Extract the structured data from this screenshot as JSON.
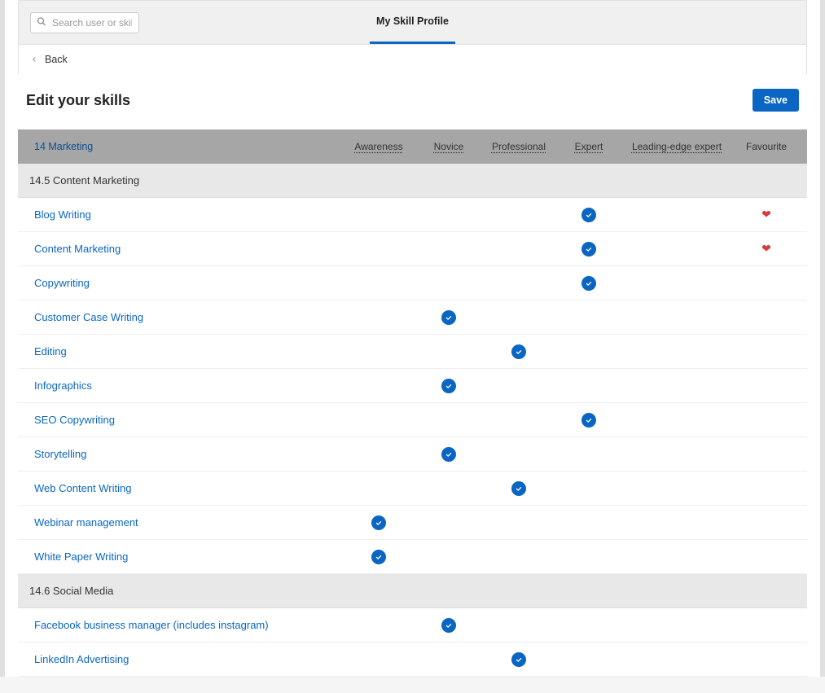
{
  "topbar": {
    "search_placeholder": "Search user or skill",
    "tab_label": "My Skill Profile"
  },
  "back_label": "Back",
  "page_title": "Edit your skills",
  "save_label": "Save",
  "header": {
    "category_link": "14 Marketing",
    "columns": [
      "Awareness",
      "Novice",
      "Professional",
      "Expert",
      "Leading-edge expert"
    ],
    "fav_label": "Favourite"
  },
  "sections": [
    {
      "title": "14.5 Content Marketing",
      "skills": [
        {
          "name": "Blog Writing",
          "level": "Expert",
          "favourite": true
        },
        {
          "name": "Content Marketing",
          "level": "Expert",
          "favourite": true
        },
        {
          "name": "Copywriting",
          "level": "Expert",
          "favourite": false
        },
        {
          "name": "Customer Case Writing",
          "level": "Novice",
          "favourite": false
        },
        {
          "name": "Editing",
          "level": "Professional",
          "favourite": false
        },
        {
          "name": "Infographics",
          "level": "Novice",
          "favourite": false
        },
        {
          "name": "SEO Copywriting",
          "level": "Expert",
          "favourite": false
        },
        {
          "name": "Storytelling",
          "level": "Novice",
          "favourite": false
        },
        {
          "name": "Web Content Writing",
          "level": "Professional",
          "favourite": false
        },
        {
          "name": "Webinar management",
          "level": "Awareness",
          "favourite": false
        },
        {
          "name": "White Paper Writing",
          "level": "Awareness",
          "favourite": false
        }
      ]
    },
    {
      "title": "14.6 Social Media",
      "skills": [
        {
          "name": "Facebook business manager (includes instagram)",
          "level": "Novice",
          "favourite": false
        },
        {
          "name": "LinkedIn Advertising",
          "level": "Professional",
          "favourite": false
        }
      ]
    }
  ],
  "levels": [
    "Awareness",
    "Novice",
    "Professional",
    "Expert",
    "Leading-edge expert"
  ]
}
